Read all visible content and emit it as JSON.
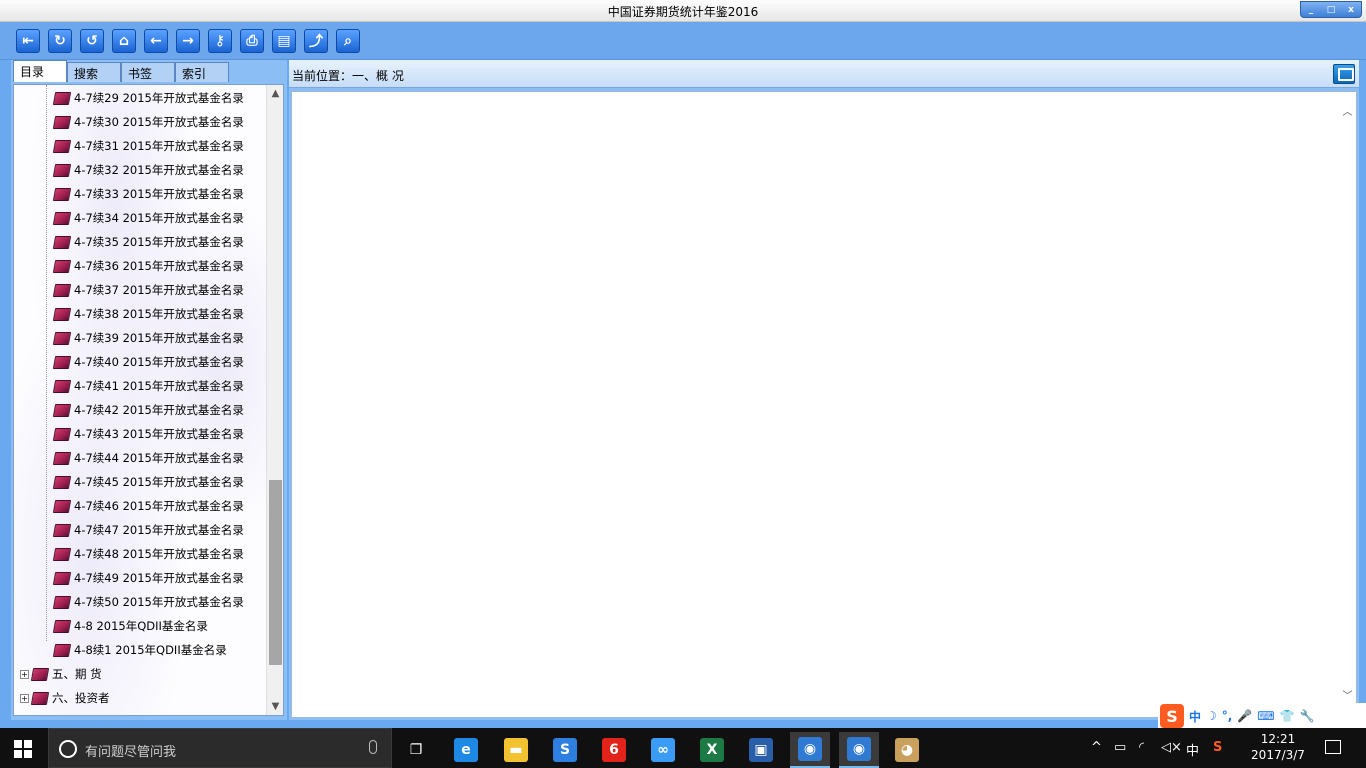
{
  "window": {
    "title": "中国证券期货统计年鉴2016",
    "controls": [
      "_",
      "□",
      "x"
    ]
  },
  "toolbar": {
    "buttons": [
      {
        "name": "exit-icon",
        "glyph": "⇤"
      },
      {
        "name": "refresh-icon",
        "glyph": "↻"
      },
      {
        "name": "undo-icon",
        "glyph": "↺"
      },
      {
        "name": "home-icon",
        "glyph": "⌂"
      },
      {
        "name": "back-arrow-icon",
        "glyph": "←"
      },
      {
        "name": "forward-arrow-icon",
        "glyph": "→"
      },
      {
        "name": "key-icon",
        "glyph": "⚷"
      },
      {
        "name": "print-icon",
        "glyph": "⎙"
      },
      {
        "name": "notes-icon",
        "glyph": "▤"
      },
      {
        "name": "export-icon",
        "glyph": "⤴"
      },
      {
        "name": "search-doc-icon",
        "glyph": "⌕"
      }
    ]
  },
  "left_panel": {
    "tabs": [
      "目录",
      "搜索",
      "书签",
      "索引"
    ],
    "active_tab": "目录",
    "tree": {
      "items": [
        {
          "label": "4-7续29 2015年开放式基金名录",
          "level": 2
        },
        {
          "label": "4-7续30 2015年开放式基金名录",
          "level": 2
        },
        {
          "label": "4-7续31 2015年开放式基金名录",
          "level": 2
        },
        {
          "label": "4-7续32 2015年开放式基金名录",
          "level": 2
        },
        {
          "label": "4-7续33 2015年开放式基金名录",
          "level": 2
        },
        {
          "label": "4-7续34 2015年开放式基金名录",
          "level": 2
        },
        {
          "label": "4-7续35 2015年开放式基金名录",
          "level": 2
        },
        {
          "label": "4-7续36 2015年开放式基金名录",
          "level": 2
        },
        {
          "label": "4-7续37 2015年开放式基金名录",
          "level": 2
        },
        {
          "label": "4-7续38 2015年开放式基金名录",
          "level": 2
        },
        {
          "label": "4-7续39 2015年开放式基金名录",
          "level": 2
        },
        {
          "label": "4-7续40 2015年开放式基金名录",
          "level": 2
        },
        {
          "label": "4-7续41 2015年开放式基金名录",
          "level": 2
        },
        {
          "label": "4-7续42 2015年开放式基金名录",
          "level": 2
        },
        {
          "label": "4-7续43 2015年开放式基金名录",
          "level": 2
        },
        {
          "label": "4-7续44 2015年开放式基金名录",
          "level": 2
        },
        {
          "label": "4-7续45 2015年开放式基金名录",
          "level": 2
        },
        {
          "label": "4-7续46 2015年开放式基金名录",
          "level": 2
        },
        {
          "label": "4-7续47 2015年开放式基金名录",
          "level": 2
        },
        {
          "label": "4-7续48 2015年开放式基金名录",
          "level": 2
        },
        {
          "label": "4-7续49 2015年开放式基金名录",
          "level": 2
        },
        {
          "label": "4-7续50 2015年开放式基金名录",
          "level": 2
        },
        {
          "label": "4-8 2015年QDII基金名录",
          "level": 2
        },
        {
          "label": "4-8续1 2015年QDII基金名录",
          "level": 2
        },
        {
          "label": "五、期  货",
          "level": 1,
          "expander": "+"
        },
        {
          "label": "六、投资者",
          "level": 1,
          "expander": "+"
        }
      ]
    },
    "scroll_position": 0.82
  },
  "right_panel": {
    "location_label": "当前位置：一、概  况"
  },
  "ime_bar": {
    "logo": "S",
    "items": [
      "中",
      "☽",
      "°,",
      "🎤",
      "⌨",
      "👕",
      "🔧"
    ]
  },
  "taskbar": {
    "search_placeholder": "有问题尽管问我",
    "apps": [
      {
        "name": "task-view-icon",
        "glyph": "❐",
        "color": "#101010",
        "active": false
      },
      {
        "name": "edge-icon",
        "glyph": "e",
        "color": "#1e88e5",
        "active": false
      },
      {
        "name": "file-explorer-icon",
        "glyph": "▬",
        "color": "#f2c230",
        "active": false
      },
      {
        "name": "sogou-browser-icon",
        "glyph": "S",
        "color": "#2d7fe0",
        "active": false
      },
      {
        "name": "netease-music-icon",
        "glyph": "6",
        "color": "#e2231a",
        "active": false
      },
      {
        "name": "baidu-netdisk-icon",
        "glyph": "∞",
        "color": "#3b9cf5",
        "active": false
      },
      {
        "name": "excel-icon",
        "glyph": "X",
        "color": "#1d7a45",
        "active": false
      },
      {
        "name": "reader-icon",
        "glyph": "▣",
        "color": "#2a5ea8",
        "active": false
      },
      {
        "name": "ebook-app-icon-1",
        "glyph": "◉",
        "color": "#2f7bd4",
        "active": true
      },
      {
        "name": "ebook-app-icon-2",
        "glyph": "◉",
        "color": "#2f7bd4",
        "active": true
      },
      {
        "name": "paint-icon",
        "glyph": "◕",
        "color": "#c9a15c",
        "active": false
      }
    ],
    "tray": {
      "chevron": "^",
      "ime_lang": "中",
      "time": "12:21",
      "date": "2017/3/7"
    }
  }
}
